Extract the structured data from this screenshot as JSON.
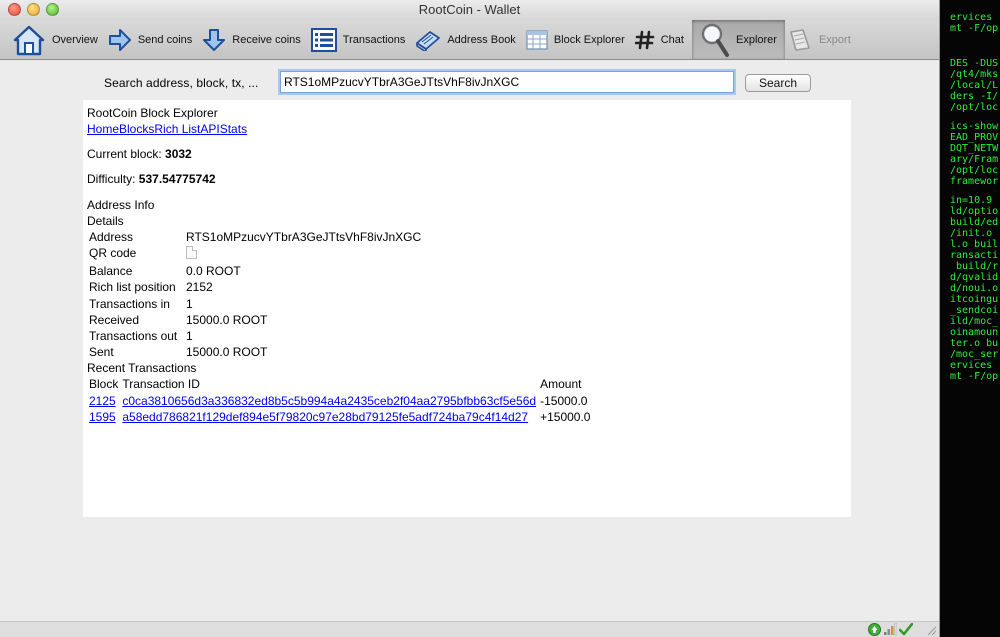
{
  "window": {
    "title": "RootCoin - Wallet"
  },
  "toolbar": {
    "items": [
      {
        "label": "Overview",
        "icon": "house-icon"
      },
      {
        "label": "Send coins",
        "icon": "arrow-right-icon"
      },
      {
        "label": "Receive coins",
        "icon": "arrow-down-icon"
      },
      {
        "label": "Transactions",
        "icon": "list-icon"
      },
      {
        "label": "Address Book",
        "icon": "address-book-icon"
      },
      {
        "label": "Block Explorer",
        "icon": "grid-icon"
      },
      {
        "label": "Chat",
        "icon": "hash-icon"
      },
      {
        "label": "Explorer",
        "icon": "magnifier-icon",
        "active": true
      },
      {
        "label": "Export",
        "icon": "export-icon",
        "disabled": true
      }
    ]
  },
  "search": {
    "label": "Search address, block, tx, ...",
    "value": "RTS1oMPzucvYTbrA3GeJTtsVhF8ivJnXGC",
    "button": "Search"
  },
  "explorer": {
    "title": "RootCoin Block Explorer",
    "nav": [
      "Home",
      "Blocks",
      "Rich List",
      "API",
      "Stats"
    ],
    "current_block_label": "Current block: ",
    "current_block": "3032",
    "difficulty_label": "Difficulty: ",
    "difficulty": "537.54775742",
    "address_info_heading": "Address Info",
    "details_heading": "Details",
    "details": [
      {
        "key": "Address",
        "value": "RTS1oMPzucvYTbrA3GeJTtsVhF8ivJnXGC"
      },
      {
        "key": "QR code",
        "value": ""
      },
      {
        "key": "Balance",
        "value": "0.0 ROOT"
      },
      {
        "key": "Rich list position",
        "value": "2152"
      },
      {
        "key": "Transactions in",
        "value": "1"
      },
      {
        "key": "Received",
        "value": "15000.0 ROOT"
      },
      {
        "key": "Transactions out",
        "value": "1"
      },
      {
        "key": "Sent",
        "value": "15000.0 ROOT"
      }
    ],
    "recent_heading": "Recent Transactions",
    "tx_columns": [
      "Block",
      "Transaction ID",
      "Amount"
    ],
    "transactions": [
      {
        "block": "2125",
        "txid": "c0ca3810656d3a336832ed8b5c5b994a4a2435ceb2f04aa2795bfbb63cf5e56d",
        "amount": "-15000.0"
      },
      {
        "block": "1595",
        "txid": "a58edd786821f129def894e5f79820c97e28bd79125fe5adf724ba79c4f14d27",
        "amount": "+15000.0"
      }
    ]
  },
  "terminal": {
    "lines": [
      "ervices",
      "mt -F/op",
      "",
      "",
      "",
      "DES -DUS",
      "/qt4/mks",
      "/local/L",
      "ders -I/",
      "/opt/loc",
      "",
      "ics-show",
      "EAD_PROV",
      "DQT_NETW",
      "ary/Fram",
      "/opt/loc",
      "framewor",
      "",
      "in=10.9",
      "ld/optio",
      "build/ed",
      "/init.o",
      "l.o buil",
      "ransacti",
      " build/r",
      "d/qvalid",
      "d/noui.o",
      "itcoingu",
      "_sendcoi",
      "ild/moc_",
      "oinamoun",
      "ter.o bu",
      "/moc_ser",
      "ervices",
      "mt -F/op"
    ]
  },
  "colors": {
    "link": "#0000ee",
    "terminal_text": "#2df03a",
    "terminal_bg": "#050505",
    "focus_ring": "#a9c8ef"
  }
}
